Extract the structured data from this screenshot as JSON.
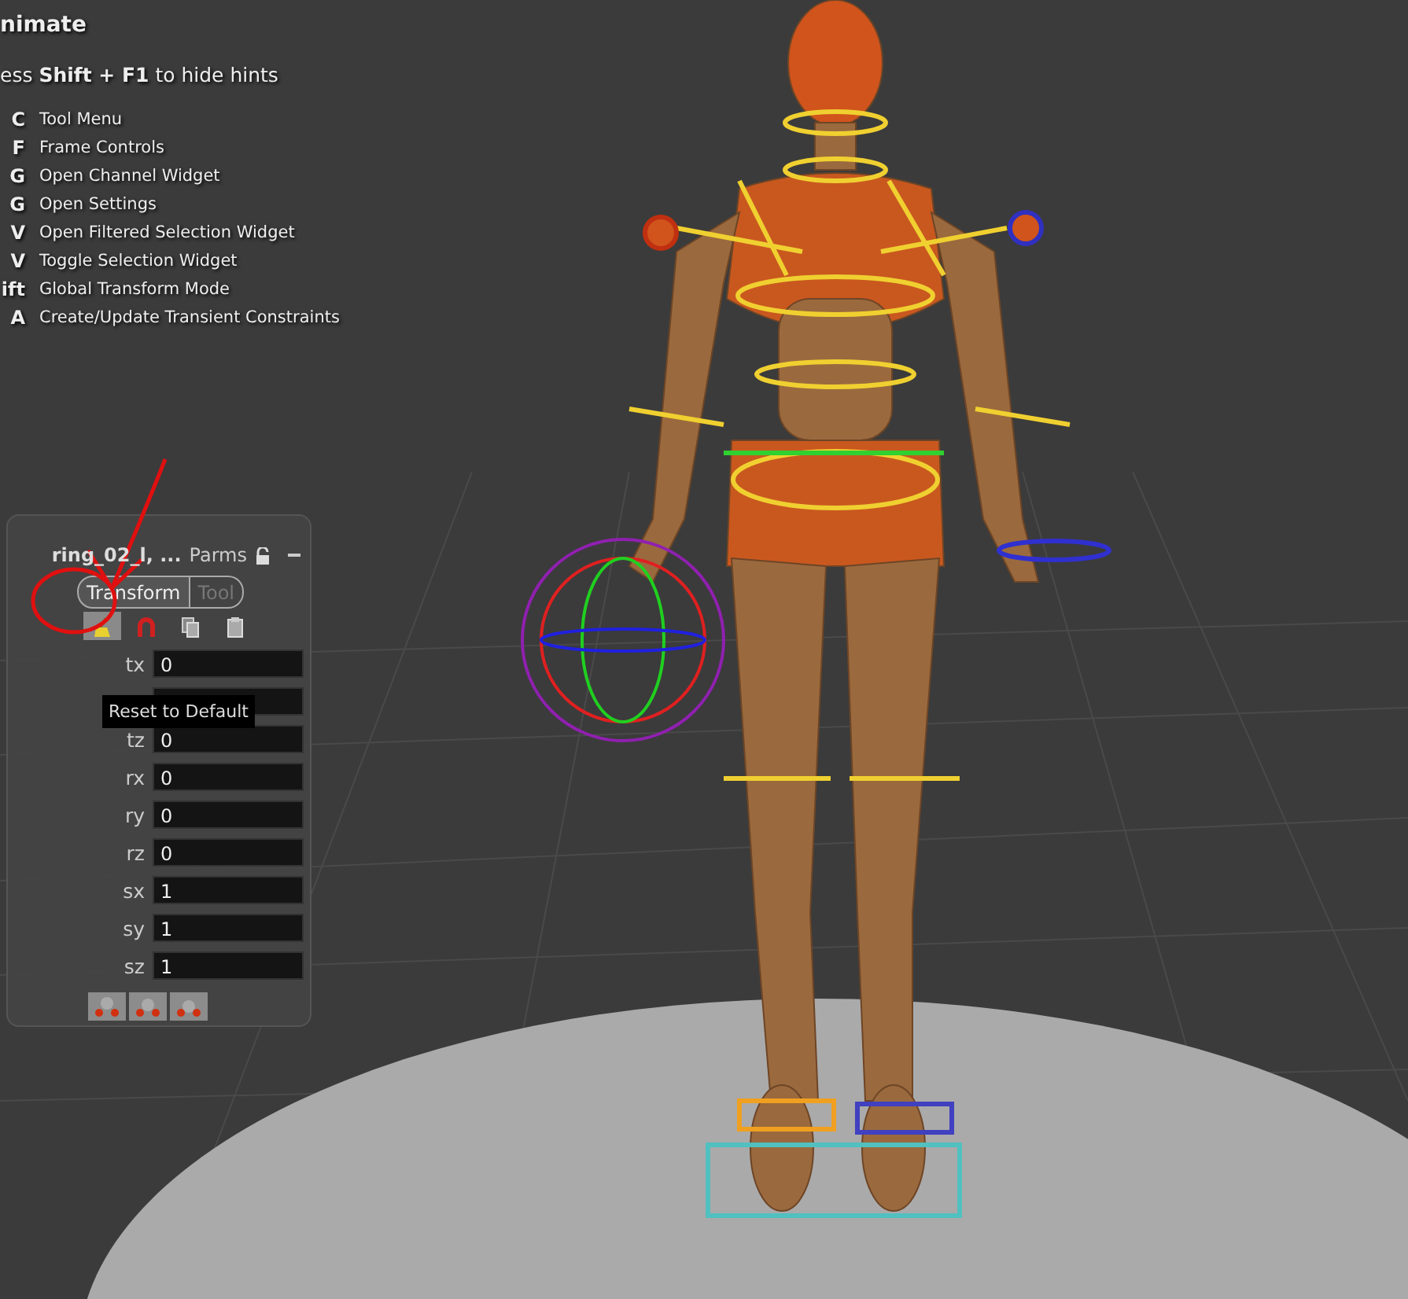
{
  "hints": {
    "title": "nimate",
    "toggle_hint": "ess **Shift + F1** to hide hints",
    "shortcuts": [
      {
        "key": "C",
        "action": "Tool Menu"
      },
      {
        "key": "F",
        "action": "Frame Controls"
      },
      {
        "key": "G",
        "action": "Open Channel Widget"
      },
      {
        "key": "G",
        "action": "Open Settings"
      },
      {
        "key": "V",
        "action": "Open Filtered Selection Widget"
      },
      {
        "key": "V",
        "action": "Toggle Selection Widget"
      },
      {
        "key": "ift",
        "action": "Global Transform Mode"
      },
      {
        "key": "A",
        "action": "Create/Update Transient Constraints"
      }
    ]
  },
  "parms_panel": {
    "title": "ring_02_l, ...",
    "label": "Parms",
    "tabs": [
      {
        "label": "Transform",
        "selected": true
      },
      {
        "label": "Tool",
        "selected": false
      }
    ],
    "toolbar": [
      {
        "kind": "broom",
        "pressed": true
      },
      {
        "kind": "magnet",
        "pressed": false
      },
      {
        "kind": "copy",
        "pressed": false
      },
      {
        "kind": "paste",
        "pressed": false
      }
    ],
    "fields": [
      {
        "kind": "value",
        "label": "tx",
        "value": "0"
      },
      {
        "kind": "covered"
      },
      {
        "kind": "value",
        "label": "tz",
        "value": "0"
      },
      {
        "kind": "value",
        "label": "rx",
        "value": "0"
      },
      {
        "kind": "value",
        "label": "ry",
        "value": "0"
      },
      {
        "kind": "value",
        "label": "rz",
        "value": "0"
      },
      {
        "kind": "value",
        "label": "sx",
        "value": "1"
      },
      {
        "kind": "value",
        "label": "sy",
        "value": "1"
      },
      {
        "kind": "value",
        "label": "sz",
        "value": "1"
      }
    ],
    "tooltip": "Reset to Default"
  }
}
